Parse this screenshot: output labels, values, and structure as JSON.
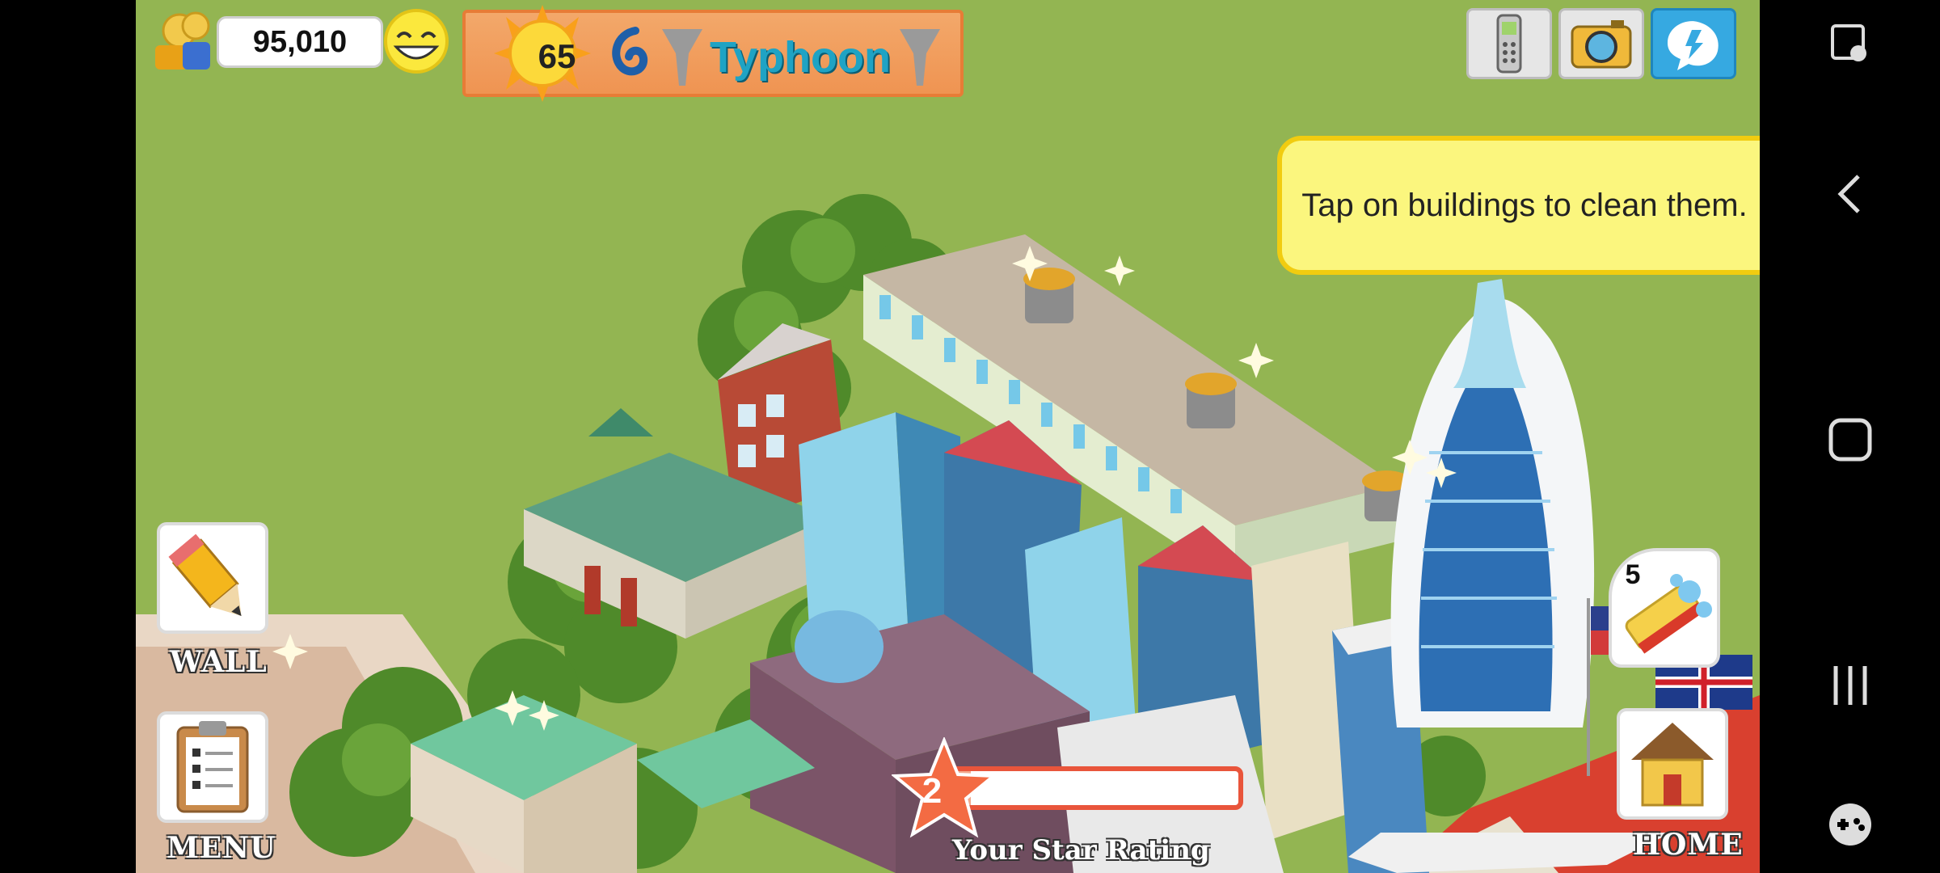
{
  "hud": {
    "coins": "95,010",
    "level": "65",
    "disaster": "Typhoon"
  },
  "tooltip": {
    "text": "Tap on buildings to clean them."
  },
  "buttons": {
    "wall_label": "WALL",
    "menu_label": "MENU",
    "home_label": "HOME",
    "clean_count": "5"
  },
  "star_rating": {
    "value": "2",
    "label": "Your Star Rating",
    "progress": 0.1
  },
  "icons": {
    "coins": "coin-stack-icon",
    "happiness": "smiley-icon",
    "level": "sun-icon",
    "disaster": "typhoon-icon",
    "phone": "mobile-phone-icon",
    "camera": "camera-icon",
    "share": "share-icon",
    "wall": "pencil-icon",
    "menu": "clipboard-icon",
    "clean": "sponge-icon",
    "home": "house-icon"
  },
  "colors": {
    "grass": "#93b552",
    "banner": "#ef9452",
    "tooltip": "#fbf67e",
    "disaster_text": "#1fa3c4"
  }
}
